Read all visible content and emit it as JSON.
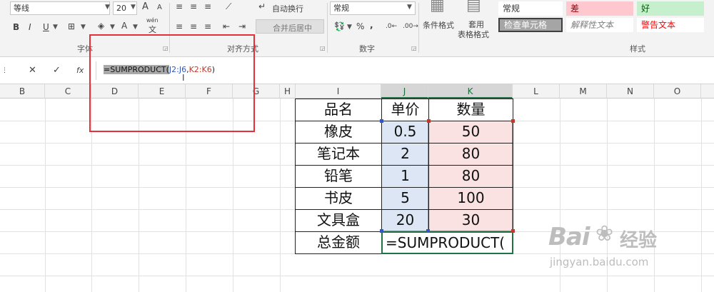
{
  "ribbon": {
    "font_name": "等线",
    "font_size": "20",
    "number_format": "常规",
    "wrap_text": "自动换行",
    "merge_center": "合并后居中",
    "conditional_format": "条件格式",
    "format_as_table_1": "套用",
    "format_as_table_2": "表格格式",
    "group_font": "字体",
    "group_align": "对齐方式",
    "group_number": "数字",
    "group_styles": "样式",
    "styles": [
      {
        "label": "常规",
        "bg": "#ffffff",
        "fg": "#333333"
      },
      {
        "label": "差",
        "bg": "#ffc7ce",
        "fg": "#9c0006"
      },
      {
        "label": "好",
        "bg": "#c6efce",
        "fg": "#006100"
      },
      {
        "label": "检查单元格",
        "bg": "#a5a5a5",
        "fg": "#ffffff"
      },
      {
        "label": "解释性文本",
        "bg": "#ffffff",
        "fg": "#7f7f7f"
      },
      {
        "label": "警告文本",
        "bg": "#ffffff",
        "fg": "#ff0000"
      }
    ],
    "bold": "B",
    "italic": "I",
    "underline": "U",
    "grow_font": "A",
    "shrink_font": "A",
    "percent": "%",
    "comma": ",",
    "pinyin_top": "wén",
    "pinyin_bottom": "文"
  },
  "formula_bar": {
    "cancel": "✕",
    "enter": "✓",
    "fx": "fx",
    "prefix": "=SUMPRODUCT(",
    "range1": "J2:J6",
    "comma": ",",
    "range2": "K2:K6",
    "suffix": ")"
  },
  "columns": [
    "B",
    "C",
    "D",
    "E",
    "F",
    "G",
    "H",
    "I",
    "J",
    "K",
    "L",
    "M",
    "N",
    "O"
  ],
  "table": {
    "headers": [
      "品名",
      "单价",
      "数量"
    ],
    "rows": [
      [
        "橡皮",
        "0.5",
        "50"
      ],
      [
        "笔记本",
        "2",
        "80"
      ],
      [
        "铅笔",
        "1",
        "80"
      ],
      [
        "书皮",
        "5",
        "100"
      ],
      [
        "文具盒",
        "20",
        "30"
      ]
    ],
    "total_label": "总金额",
    "total_formula": "=SUMPRODUCT("
  },
  "colors": {
    "accent_green": "#217346",
    "range1_fill": "#dce6f4",
    "range2_fill": "#fbe2e2",
    "highlight_box": "#e5303a"
  },
  "watermark": {
    "brand": "Bai",
    "brand2": "经验",
    "url": "jingyan.baidu.com"
  }
}
